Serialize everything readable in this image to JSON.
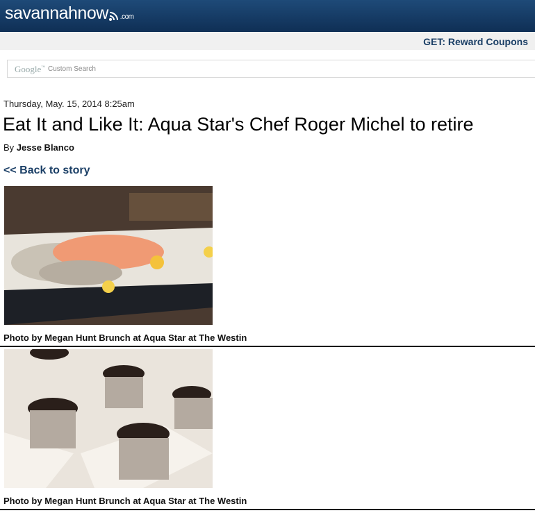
{
  "header": {
    "logo_main": "savannahnow",
    "logo_suffix": ".com",
    "brand_color": "#16406b"
  },
  "getbar": {
    "link": "GET: Reward Coupons"
  },
  "search": {
    "brand": "Google",
    "placeholder": "Custom Search"
  },
  "article": {
    "date": "Thursday, May. 15, 2014 8:25am",
    "title": "Eat It and Like It: Aqua Star's Chef Roger Michel to retire",
    "byline_prefix": "By",
    "author": "Jesse Blanco",
    "back_link": "<< Back to story"
  },
  "photos": [
    {
      "icon": "seafood-photo",
      "caption": "Photo by Megan Hunt Brunch at Aqua Star at The Westin"
    },
    {
      "icon": "dessert-photo",
      "caption": "Photo by Megan Hunt Brunch at Aqua Star at The Westin"
    }
  ]
}
